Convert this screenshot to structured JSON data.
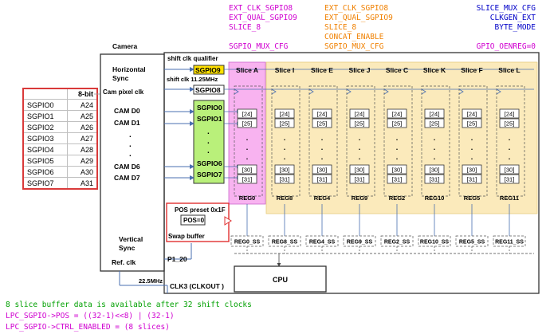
{
  "headers": {
    "col1": [
      "EXT_CLK_SGPIO8",
      "EXT_QUAL_SGPIO9",
      "SLICE_8",
      "",
      "SGPIO_MUX_CFG"
    ],
    "col2": [
      "EXT_CLK_SGPIO8",
      "EXT_QUAL_SGPIO9",
      "SLICE_8",
      "CONCAT_ENABLE",
      "SGPIO_MUX_CFG"
    ],
    "col3": [
      "SLICE_MUX_CFG",
      "CLKGEN_EXT",
      "BYTE_MODE",
      "",
      "GPIO_OENREG=0"
    ],
    "colors": {
      "magenta": "#d000d0",
      "orange": "#f08000",
      "blue": "#0000c8",
      "green": "#00a000"
    }
  },
  "pin_table": {
    "header": "8-bit",
    "rows": [
      [
        "SGPIO0",
        "A24"
      ],
      [
        "SGPIO1",
        "A25"
      ],
      [
        "SGPIO2",
        "A26"
      ],
      [
        "SGPIO3",
        "A27"
      ],
      [
        "SGPIO4",
        "A28"
      ],
      [
        "SGPIO5",
        "A29"
      ],
      [
        "SGPIO6",
        "A30"
      ],
      [
        "SGPIO7",
        "A31"
      ]
    ]
  },
  "camera": {
    "title": "Camera",
    "hsync": "Horizontal Sync",
    "pixel_clk": "Cam pixel clk",
    "d0": "CAM D0",
    "d1": "CAM D1",
    "d6": "CAM D6",
    "d7": "CAM D7",
    "vsync": "Vertical Sync",
    "ref_clk": "Ref. clk",
    "freq": "22.5MHz"
  },
  "qualifier": {
    "title": "shift clk qualifier",
    "sgpio9": "SGPIO9",
    "shift_clk": "shift clk 11.25MHz",
    "sgpio8": "SGPIO8"
  },
  "sgpio_pins": [
    "SGPIO0",
    "SGPIO1",
    "SGPIO6",
    "SGPIO7"
  ],
  "slices": [
    "Slice A",
    "Slice I",
    "Slice E",
    "Slice J",
    "Slice C",
    "Slice K",
    "Slice F",
    "Slice L"
  ],
  "regs": [
    "REG0",
    "REG8",
    "REG4",
    "REG9",
    "REG2",
    "REG10",
    "REG5",
    "REG11"
  ],
  "ss": [
    "REG0_SS",
    "REG8_SS",
    "REG4_SS",
    "REG9_SS",
    "REG2_SS",
    "REG10_SS",
    "REG5_SS",
    "REG11_SS"
  ],
  "bits": [
    "[24]",
    "[25]",
    "[30]",
    "[31]"
  ],
  "pos": {
    "preset": "POS preset 0x1F",
    "value": "POS=0",
    "swap": "Swap buffer"
  },
  "misc": {
    "p1_20": "P1_20",
    "cpu": "CPU",
    "clk3": "CLK3 (CLKOUT )"
  },
  "footer": {
    "line1": "8 slice buffer data is available after 32 shift clocks",
    "line2": "LPC_SGPIO->POS = ((32-1)<<8) | (32-1)",
    "line3": "LPC_SGPIO->CTRL_ENABLED = (8 slices)"
  }
}
